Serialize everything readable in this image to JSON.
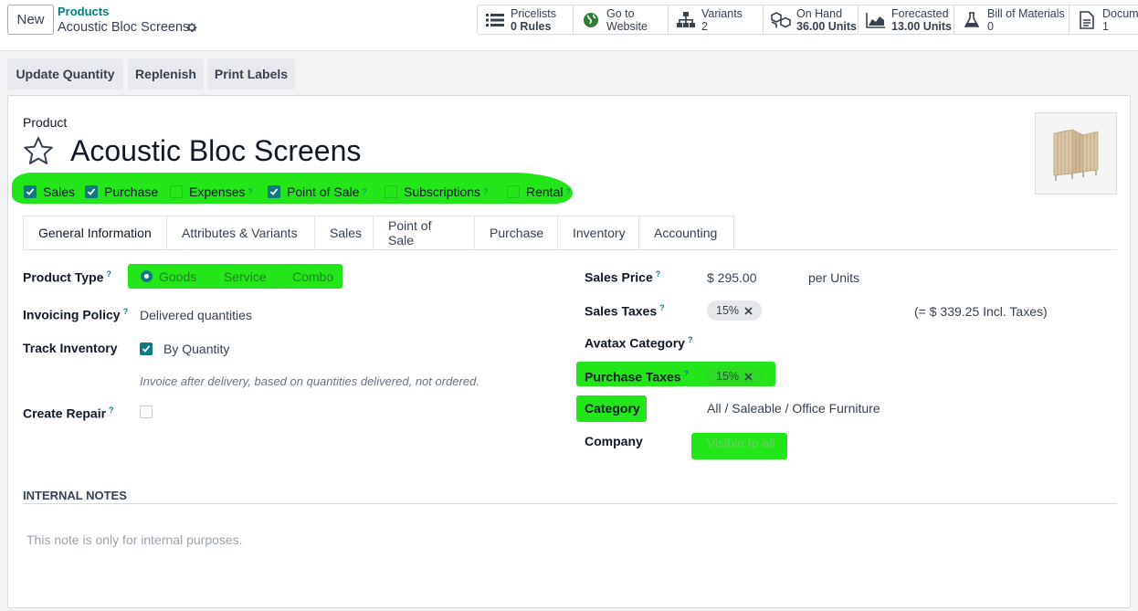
{
  "header": {
    "new_button": "New",
    "breadcrumb_parent": "Products",
    "record_name": "Acoustic Bloc Screens"
  },
  "stats": [
    {
      "icon": "list-icon",
      "label": "Pricelists",
      "value": "0 Rules"
    },
    {
      "icon": "globe-icon",
      "label": "Go to",
      "value": "Website"
    },
    {
      "icon": "sitemap-icon",
      "label": "Variants",
      "value": "2"
    },
    {
      "icon": "cubes-icon",
      "label": "On Hand",
      "value": "36.00 Units"
    },
    {
      "icon": "area-chart-icon",
      "label": "Forecasted",
      "value": "13.00 Units"
    },
    {
      "icon": "flask-icon",
      "label": "Bill of Materials",
      "value": "0"
    },
    {
      "icon": "document-icon",
      "label": "Documents",
      "value": "1"
    }
  ],
  "actions": {
    "update_quantity": "Update Quantity",
    "replenish": "Replenish",
    "print_labels": "Print Labels"
  },
  "product": {
    "type_label": "Product",
    "name": "Acoustic Bloc Screens",
    "flags": [
      {
        "label": "Sales",
        "checked": true
      },
      {
        "label": "Purchase",
        "checked": true
      },
      {
        "label": "Expenses",
        "checked": false,
        "tip": "?"
      },
      {
        "label": "Point of Sale",
        "checked": true,
        "tip": "?"
      },
      {
        "label": "Subscriptions",
        "checked": false,
        "tip": "?"
      },
      {
        "label": "Rental",
        "checked": false,
        "tip": "?"
      }
    ]
  },
  "tabs": [
    "General Information",
    "Attributes & Variants",
    "Sales",
    "Point of Sale",
    "Purchase",
    "Inventory",
    "Accounting"
  ],
  "form": {
    "product_type": {
      "label": "Product Type",
      "tip": "?",
      "options": [
        "Goods",
        "Service",
        "Combo"
      ],
      "selected": "Goods"
    },
    "invoicing_policy": {
      "label": "Invoicing Policy",
      "tip": "?",
      "value": "Delivered quantities"
    },
    "track_inventory": {
      "label": "Track Inventory",
      "value": "By Quantity"
    },
    "invoice_hint": "Invoice after delivery, based on quantities delivered, not ordered.",
    "create_repair": {
      "label": "Create Repair",
      "tip": "?"
    },
    "sales_price": {
      "label": "Sales Price",
      "tip": "?",
      "value": "$ 295.00",
      "unit": "per Units"
    },
    "sales_taxes": {
      "label": "Sales Taxes",
      "tip": "?",
      "tag": "15%",
      "incl": "(= $ 339.25 Incl. Taxes)"
    },
    "avatax_category": {
      "label": "Avatax Category",
      "tip": "?"
    },
    "purchase_taxes": {
      "label": "Purchase Taxes",
      "tip": "?",
      "tag": "15%"
    },
    "category": {
      "label": "Category",
      "value": "All / Saleable / Office Furniture"
    },
    "company": {
      "label": "Company",
      "placeholder": "Visible to all"
    }
  },
  "notes": {
    "title": "INTERNAL NOTES",
    "placeholder": "This note is only for internal purposes."
  },
  "colors": {
    "accent": "#017e84",
    "highlight": "#22e61a",
    "checkbox": "#0f7b80"
  }
}
